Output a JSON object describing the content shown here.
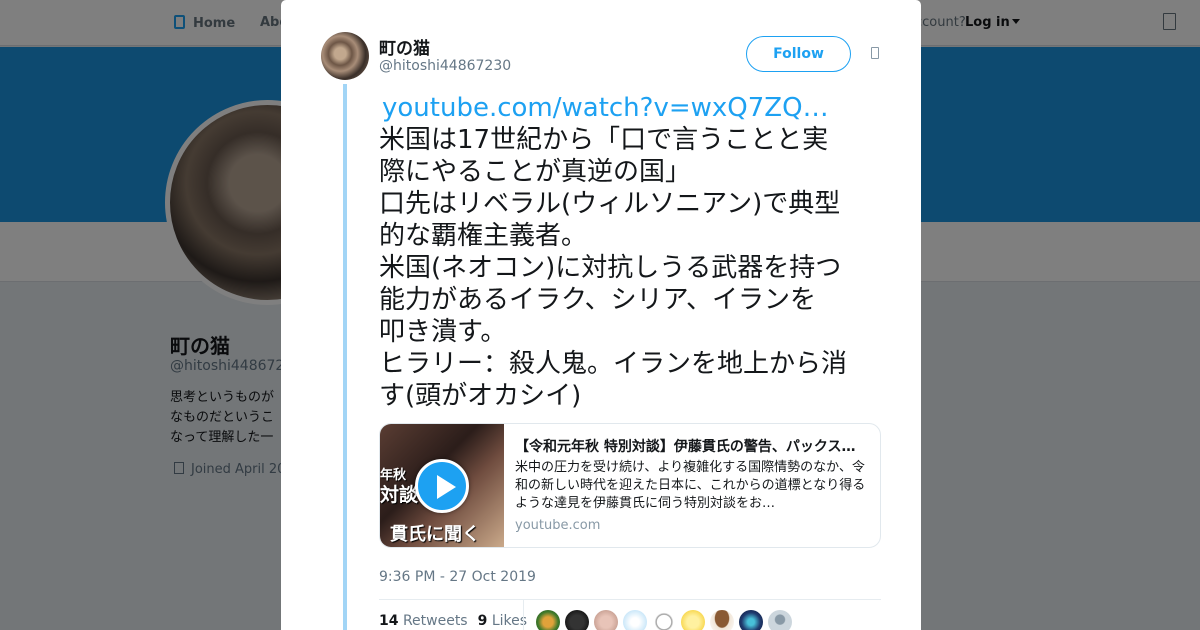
{
  "nav": {
    "home": "Home",
    "about": "Abo",
    "account_prompt": "ccount?",
    "login": "Log in"
  },
  "profile": {
    "name": "町の猫",
    "handle": "@hitoshi44867230",
    "bio_lines": [
      "思考というものが",
      "なものだというこ",
      "なって理解した一"
    ],
    "joined": "Joined April 20"
  },
  "tweet": {
    "author_name": "町の猫",
    "author_handle": "@hitoshi44867230",
    "follow_label": "Follow",
    "link": "youtube.com/watch?v=wxQ7ZQ…",
    "lines": [
      "米国は17世紀から「口で言うことと実",
      "際にやることが真逆の国」",
      "口先はリベラル(ウィルソニアン)で典型",
      "的な覇権主義者。",
      "米国(ネオコン)に対抗しうる武器を持つ",
      "能力があるイラク、シリア、イランを",
      "叩き潰す。",
      "ヒラリー：殺人鬼。イランを地上から消",
      "す(頭がオカシイ)"
    ],
    "card": {
      "title": "【令和元年秋 特別対談】伊藤貫氏の警告、パックス…",
      "description": "米中の圧力を受け続け、より複雑化する国際情勢のなか、令和の新しい時代を迎えた日本に、これからの道標となり得るような達見を伊藤貫氏に伺う特別対談をお…",
      "domain": "youtube.com",
      "thumb_text": [
        "年秋",
        "対談",
        "貫氏に聞く"
      ]
    },
    "timestamp": "9:36 PM - 27 Oct 2019",
    "retweets_count": "14",
    "retweets_label": "Retweets",
    "likes_count": "9",
    "likes_label": "Likes"
  },
  "colors": {
    "accent": "#1da1f2",
    "banner": "#1b95e0",
    "thread_line": "#a2d5f6"
  },
  "icons": [
    "home-icon",
    "search-icon",
    "calendar-icon",
    "caret-down-icon",
    "play-icon"
  ]
}
